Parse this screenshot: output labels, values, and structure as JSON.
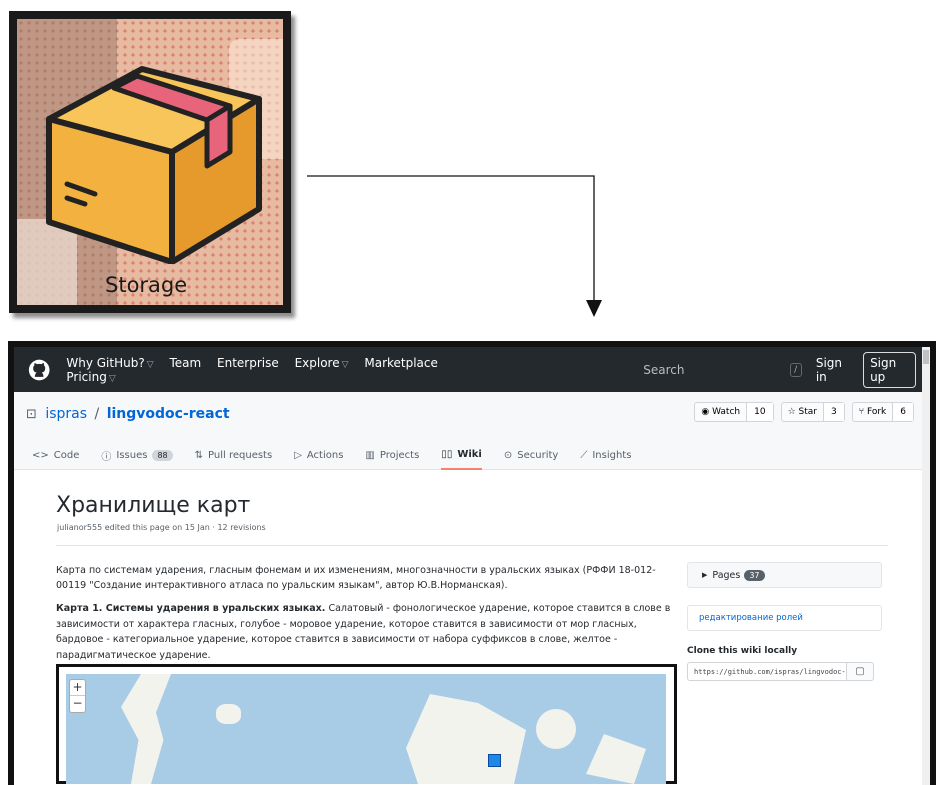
{
  "tile": {
    "label": "Storage",
    "icon": "package-box-icon"
  },
  "browser": {
    "header": {
      "nav": [
        "Why GitHub?",
        "Team",
        "Enterprise",
        "Explore",
        "Marketplace",
        "Pricing"
      ],
      "search": "Search",
      "slash": "/",
      "sign_in": "Sign in",
      "sign_up": "Sign up"
    },
    "repo": {
      "owner": "ispras",
      "name": "lingvodoc-react",
      "watch": "Watch",
      "watch_count": "10",
      "star": "Star",
      "star_count": "3",
      "fork": "Fork",
      "fork_count": "6"
    },
    "tabs": {
      "code": "Code",
      "issues": "Issues",
      "issues_count": "88",
      "pulls": "Pull requests",
      "actions": "Actions",
      "projects": "Projects",
      "wiki": "Wiki",
      "security": "Security",
      "insights": "Insights"
    },
    "wiki": {
      "title": "Хранилище карт",
      "meta": "julianor555 edited this page on 15 Jan · 12 revisions",
      "p1": "Карта по системам ударения, гласным фонемам и их изменениям, многозначности в уральских языках (РФФИ 18-012-00119 \"Создание интерактивного атласа по уральским языкам\", автор Ю.В.Норманская).",
      "p2_bold": "Карта 1. Системы ударения в уральских языках.",
      "p2_rest": " Салатовый - фонологическое ударение, которое ставится в слове в зависимости от характера гласных, голубое - моровое ударение, которое ставится в зависимости от мор гласных, бардовое - категориальное ударение, которое ставится в зависимости от набора суффиксов в слове, желтое - парадигматическое ударение.",
      "zoom_in": "+",
      "zoom_out": "−"
    },
    "sidebar": {
      "pages": "Pages",
      "pages_count": "37",
      "link": "редактирование ролей",
      "clone_heading": "Clone this wiki locally",
      "clone_url": "https://github.com/ispras/lingvodoc-react.wiki.git"
    }
  },
  "colors": {
    "header": "#24292e",
    "link": "#0366d6",
    "tab_active": "#f9826c",
    "tile_bg": "#e7bba1"
  }
}
